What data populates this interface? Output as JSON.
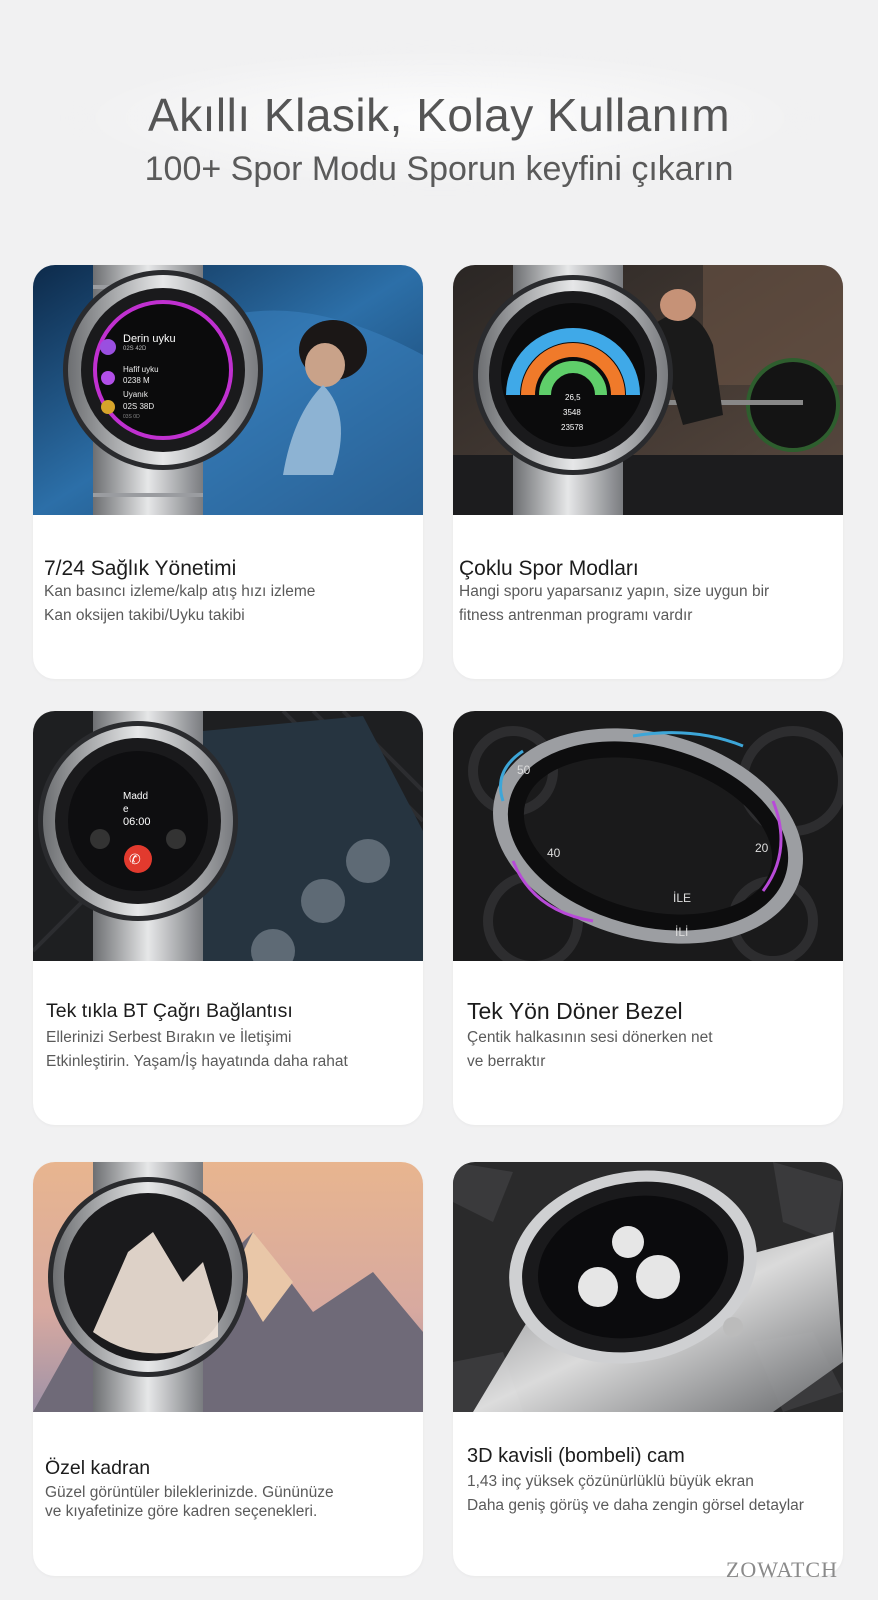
{
  "header": {
    "title": "Akıllı Klasik, Kolay Kullanım",
    "subtitle": "100+ Spor Modu Sporun keyfini çıkarın"
  },
  "cards": [
    {
      "title": "7/24 Sağlık Yönetimi",
      "lines": [
        "Kan basıncı izleme/kalp atış hızı izleme",
        "Kan oksijen takibi/Uyku takibi"
      ],
      "screen": {
        "l1": "Derin uyku",
        "l1v": "02S 42D",
        "l2": "Hafif uyku",
        "l2v": "0238 M",
        "l3": "Uyanık",
        "l3v": "02S 38D",
        "l3b": "03S 0D"
      }
    },
    {
      "title": "Çoklu Spor Modları",
      "lines": [
        "Hangi sporu yaparsanız yapın, size uygun bir",
        "fitness antrenman programı vardır"
      ],
      "screen": {
        "v1": "26,5",
        "v2": "3548",
        "v3": "23578"
      }
    },
    {
      "title": "Tek tıkla BT Çağrı Bağlantısı",
      "lines": [
        "Ellerinizi Serbest Bırakın ve İletişimi",
        "Etkinleştirin. Yaşam/İş hayatında daha rahat"
      ],
      "screen": {
        "name": "Madd",
        "sub": "e",
        "time": "06:00"
      }
    },
    {
      "title": "Tek Yön Döner Bezel",
      "lines": [
        "Çentik halkasının sesi dönerken net",
        "ve berraktır"
      ],
      "screen": {
        "a": "İLE",
        "b": "İLİ",
        "n1": "50",
        "n2": "40",
        "n3": "20"
      }
    },
    {
      "title": "Özel kadran",
      "lines": [
        "Güzel görüntüler bileklerinizde. Gününüze",
        "ve kıyafetinize göre kadren seçenekleri."
      ],
      "screen": {}
    },
    {
      "title": "3D kavisli (bombeli) cam",
      "lines": [
        "1,43 inç yüksek çözünürlüklü büyük ekran",
        "Daha geniş görüş ve daha zengin görsel detaylar"
      ],
      "screen": {}
    }
  ],
  "brand": "ZOWATCH"
}
